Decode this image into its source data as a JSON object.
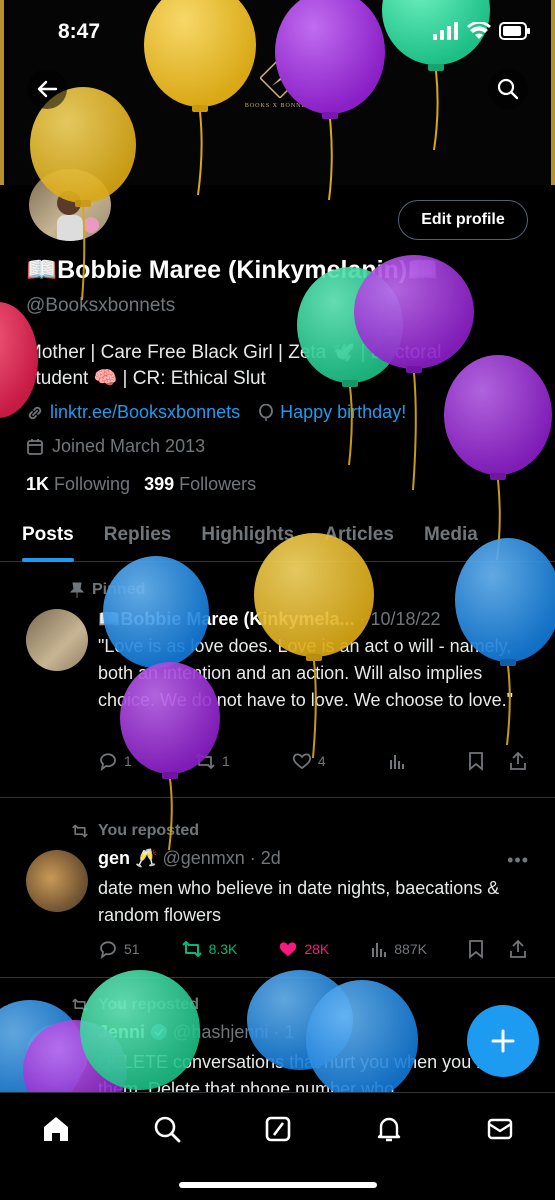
{
  "status_bar": {
    "time": "8:47"
  },
  "banner": {
    "logo_text": "BOOKS X BONNETS"
  },
  "profile": {
    "edit_button": "Edit profile",
    "name": "📖Bobbie Maree (Kinkymelanin)📖",
    "handle": "@Booksxbonnets",
    "bio": "Mother | Care Free Black Girl | Zeta 🕊️ | Doctoral student 🧠 | CR: Ethical Slut",
    "link": "linktr.ee/Booksxbonnets",
    "birthday": "Happy birthday!",
    "joined": "Joined March 2013",
    "following_count": "1K",
    "following_label": "Following",
    "followers_count": "399",
    "followers_label": "Followers"
  },
  "tabs": [
    {
      "label": "Posts"
    },
    {
      "label": "Replies"
    },
    {
      "label": "Highlights"
    },
    {
      "label": "Articles"
    },
    {
      "label": "Media"
    }
  ],
  "posts": [
    {
      "context": "Pinned",
      "name": "📖Bobbie Maree (Kinkymela...",
      "meta": "· 10/18/22",
      "text": "\"Love is as love does. Love is an act o will - namely, both an intention and an action. Will also implies choice. We do not have to love. We choose to love.\"",
      "replies": "1",
      "reposts": "1",
      "likes": "4",
      "views": ""
    },
    {
      "context": "You reposted",
      "name": "gen 🥂",
      "meta": "@genmxn · 2d",
      "text": "date men who believe in date nights, baecations & random flowers",
      "replies": "51",
      "reposts": "8.3K",
      "likes": "28K",
      "views": "887K"
    },
    {
      "context": "You reposted",
      "name": "Jenni",
      "meta": "@hashjenni · 1",
      "text": "DELETE conversations that hurt you when you read them. Delete that phone number who"
    }
  ],
  "colors": {
    "accent": "#1d9bf0",
    "repost": "#00ba7c",
    "like": "#f91880",
    "balloon_yellow": "#e8b923",
    "balloon_purple": "#9b2fd6",
    "balloon_green": "#2ed39a",
    "balloon_blue": "#1e90e8",
    "balloon_red": "#e0264f"
  }
}
